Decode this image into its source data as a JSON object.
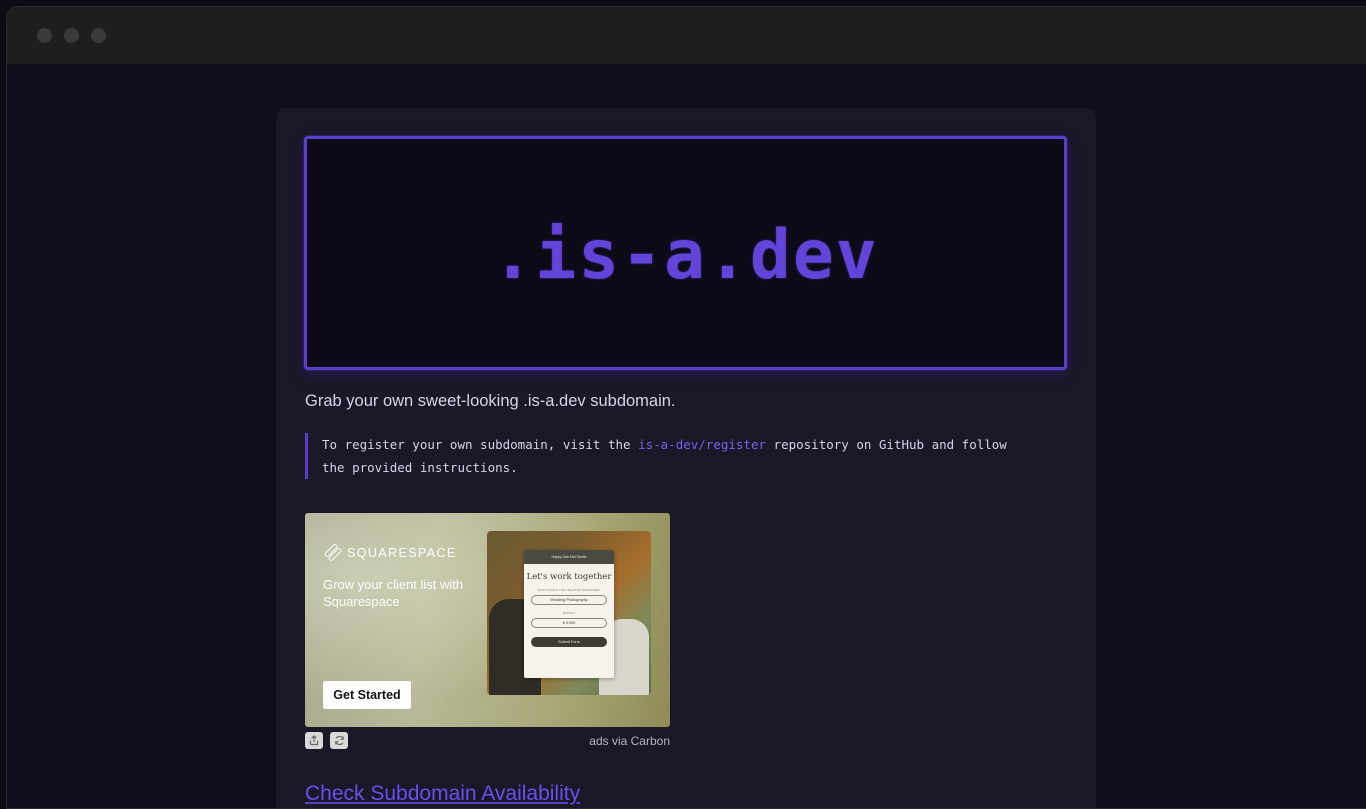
{
  "hero": {
    "logo_text": ".is-a.dev"
  },
  "tagline": "Grab your own sweet-looking .is-a.dev subdomain.",
  "note": {
    "before_link": "To register your own subdomain, visit the ",
    "link_text": "is-a-dev/register",
    "after_link": " repository on GitHub and follow the provided instructions."
  },
  "ad": {
    "brand": "SQUARESPACE",
    "headline": "Grow your client list with Squarespace",
    "cta": "Get Started",
    "form": {
      "header": "Happy Oak Mai Studio",
      "title": "Let's work together",
      "label_1": "WHAT WOULD YOU LIKE PHOTOGRAPHED?",
      "field_1": "Wedding Photography",
      "label_2": "BUDGET",
      "field_2": "$ 5,000",
      "submit": "Submit Form"
    },
    "attribution": "ads via Carbon",
    "icons": {
      "share": "share-icon",
      "refresh": "refresh-icon"
    }
  },
  "section": {
    "title": "Check Subdomain Availability"
  },
  "colors": {
    "accent": "#6244d8",
    "background": "#100d1d",
    "card": "#1a1726"
  }
}
